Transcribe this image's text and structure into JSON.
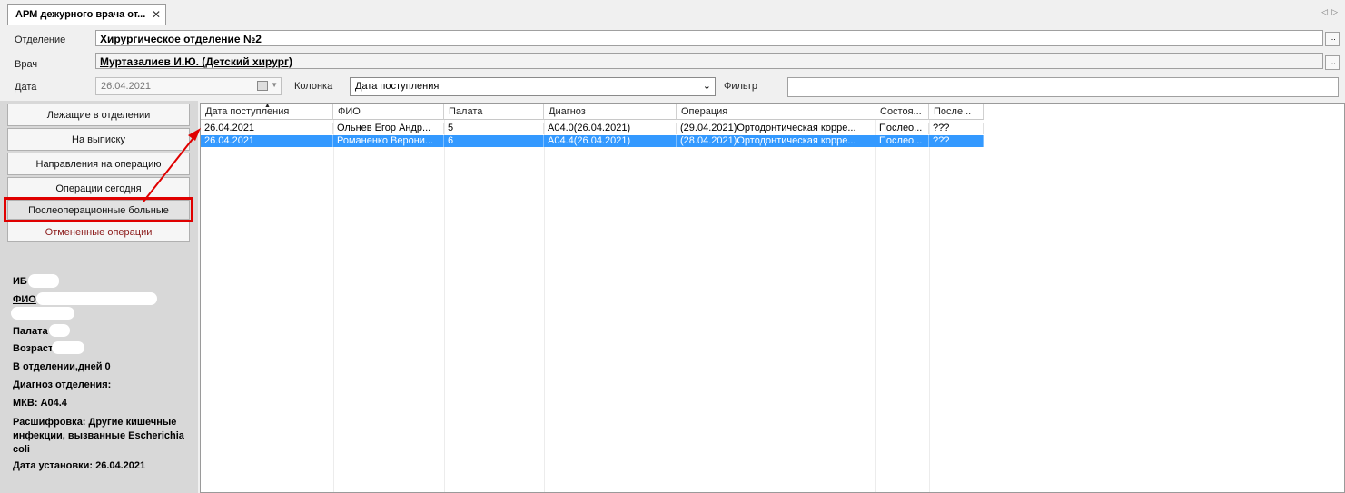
{
  "tab": {
    "title": "АРМ дежурного врача от...",
    "close": "✕",
    "nav": "◁▷"
  },
  "form": {
    "department_label": "Отделение",
    "department_value": "Хирургическое отделение №2",
    "doctor_label": "Врач",
    "doctor_value": "Муртазалиев И.Ю. (Детский хирург)",
    "date_label": "Дата",
    "date_value": "26.04.2021",
    "column_label": "Колонка",
    "column_value": "Дата поступления",
    "filter_label": "Фильтр",
    "filter_value": "",
    "ellipsis": "..."
  },
  "nav": {
    "items": [
      {
        "label": "Лежащие в отделении"
      },
      {
        "label": "На выписку"
      },
      {
        "label": "Направления на операцию"
      },
      {
        "label": "Операции сегодня"
      },
      {
        "label": "Послеоперационные больные"
      },
      {
        "label": "Отмененные операции"
      }
    ]
  },
  "patient": {
    "ib_label": "ИБ",
    "fio_label": "ФИО",
    "ward_label": "Палата",
    "age_label": "Возраст",
    "days": "В отделении,дней 0",
    "diagnosis_label": "Диагноз отделения:",
    "mkb": "МКВ: А04.4",
    "decoding": "Расшифровка: Другие кишечные инфекции, вызванные Escherichia coli",
    "set_date": "Дата установки: 26.04.2021"
  },
  "table": {
    "columns": [
      "Дата поступления",
      "ФИО",
      "Палата",
      "Диагноз",
      "Операция",
      "Состоя...",
      "После..."
    ],
    "rows": [
      [
        "26.04.2021",
        "Ольнев Егор Андр...",
        "5",
        "А04.0(26.04.2021)",
        "(29.04.2021)Ортодонтическая корре...",
        "Послео...",
        "???"
      ],
      [
        "26.04.2021",
        "Романенко Верони...",
        "6",
        "А04.4(26.04.2021)",
        "(28.04.2021)Ортодонтическая корре...",
        "Послео...",
        "???"
      ]
    ],
    "selected_row": 1,
    "sort_indicator": "▲"
  },
  "colors": {
    "selection": "#3399ff",
    "highlight_border": "#e00000",
    "arrow": "#e00000"
  }
}
